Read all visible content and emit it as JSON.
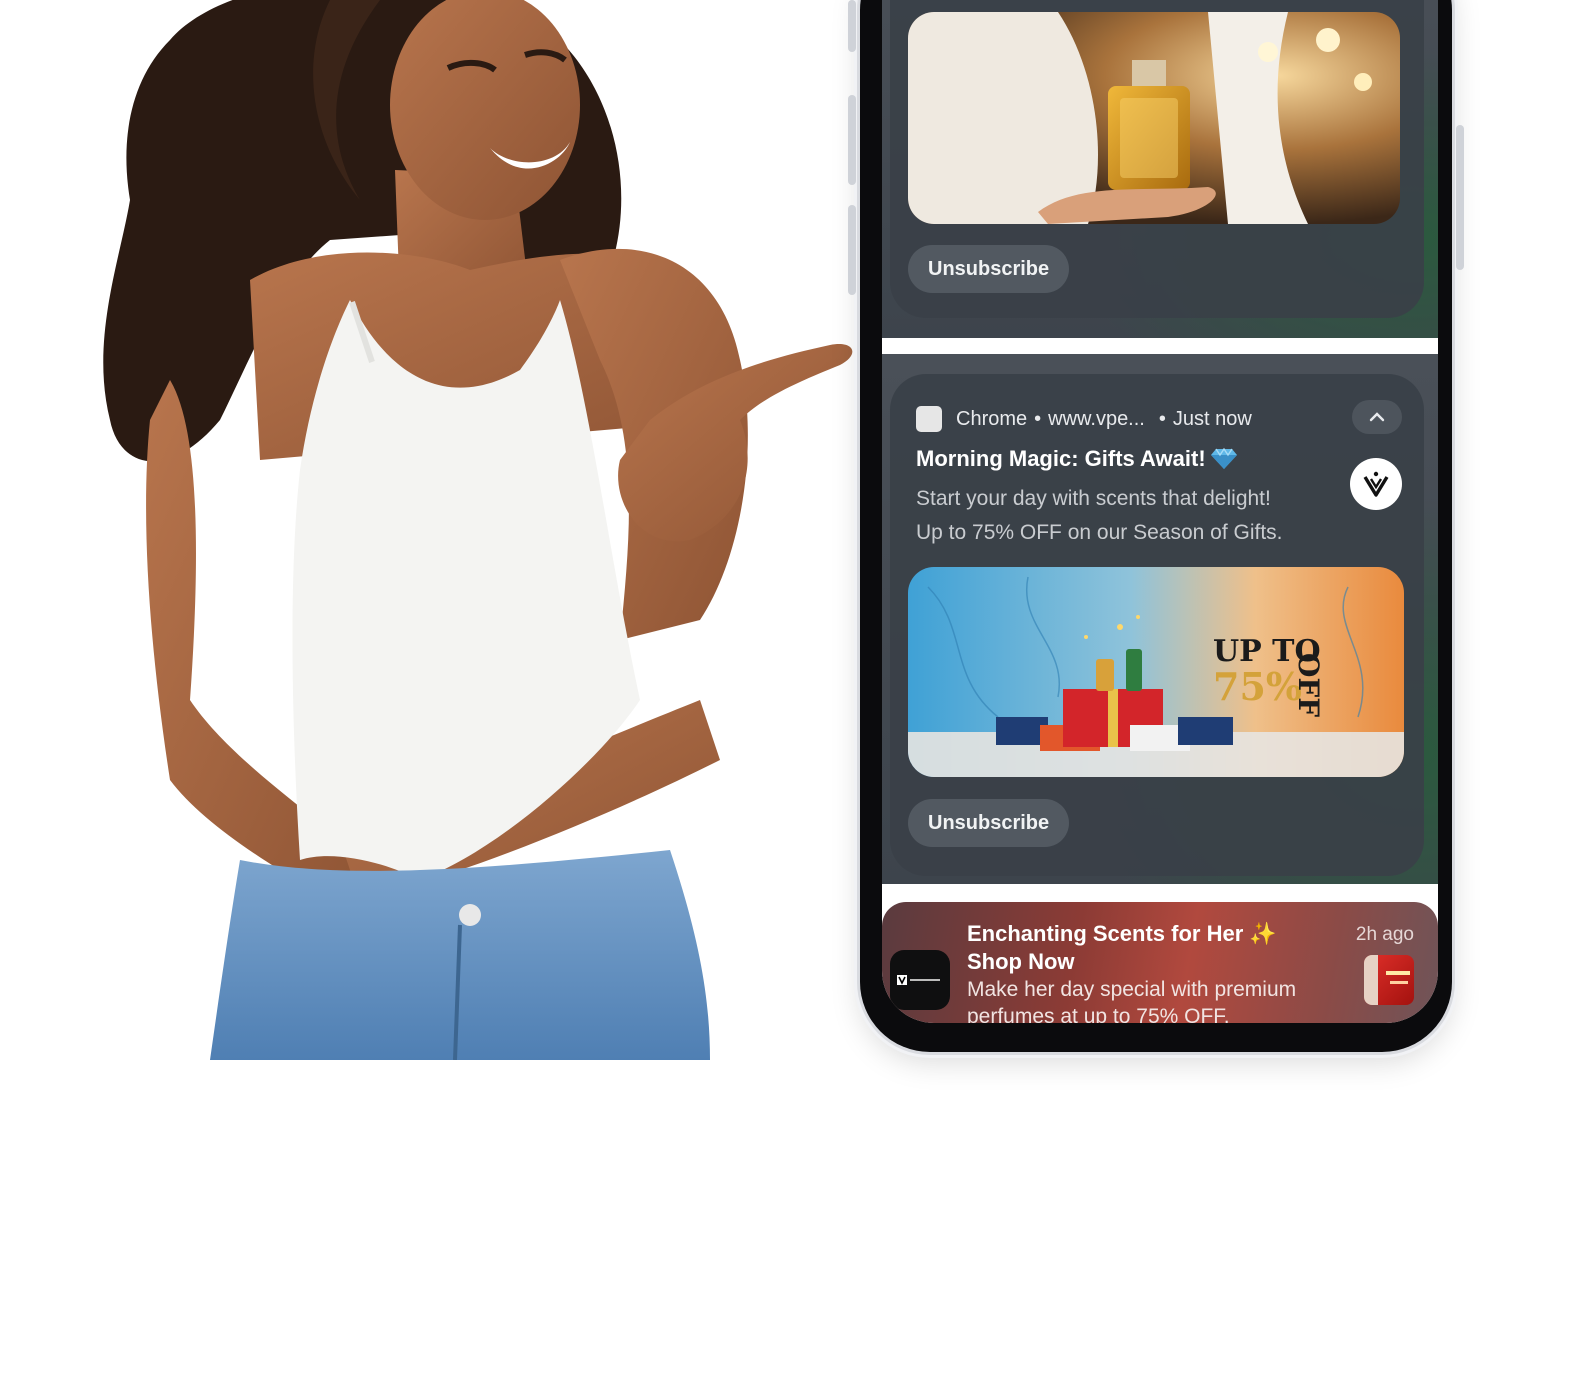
{
  "notification_top": {
    "unsubscribe_label": "Unsubscribe"
  },
  "notification_main": {
    "app_name": "Chrome",
    "separator": "•",
    "site": "www.vpe...",
    "time": "Just now",
    "title": "Morning Magic: Gifts Await!",
    "title_emoji": "diamond-icon",
    "body_line1": "Start your day with scents that delight!",
    "body_line2": "Up to 75% OFF on our Season of Gifts.",
    "banner_text_line1": "UP TO",
    "banner_text_line2": "75%",
    "banner_text_line3": "OFF",
    "unsubscribe_label": "Unsubscribe"
  },
  "notification_bottom": {
    "title_line1": "Enchanting Scents for Her ✨",
    "title_line2": "Shop Now",
    "time": "2h ago",
    "body": "Make her day special with premium perfumes at up to 75% OFF."
  },
  "colors": {
    "card_bg": "#3d444c",
    "chip_bg": "#525961",
    "accent_green": "#2b5a3e",
    "bottom_card_red": "#b1493e",
    "gold": "#d4a23a"
  }
}
